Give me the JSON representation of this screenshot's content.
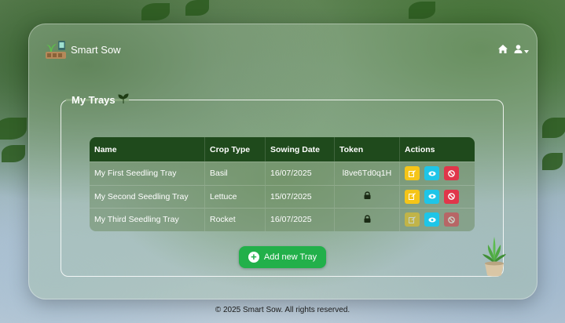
{
  "brand": {
    "name": "Smart Sow"
  },
  "nav": {
    "home_icon": "home-icon",
    "user_icon": "user-icon"
  },
  "section": {
    "title": "My Trays",
    "title_icon": "sprout-icon"
  },
  "table": {
    "headers": [
      "Name",
      "Crop Type",
      "Sowing Date",
      "Token",
      "Actions"
    ],
    "rows": [
      {
        "name": "My First Seedling Tray",
        "crop": "Basil",
        "date": "16/07/2025",
        "token": "l8ve6Td0q1H",
        "locked": false,
        "delete_disabled": false
      },
      {
        "name": "My Second Seedling Tray",
        "crop": "Lettuce",
        "date": "15/07/2025",
        "token": "",
        "locked": true,
        "delete_disabled": false
      },
      {
        "name": "My Third Seedling Tray",
        "crop": "Rocket",
        "date": "16/07/2025",
        "token": "",
        "locked": true,
        "delete_disabled": true
      }
    ]
  },
  "add_button": {
    "label": "Add new Tray"
  },
  "footer": {
    "text": "© 2025 Smart Sow. All rights reserved."
  },
  "colors": {
    "header": "#1f4a1c",
    "edit": "#f5c518",
    "view": "#1ec5e8",
    "delete": "#e0364a",
    "add": "#22b04a"
  }
}
